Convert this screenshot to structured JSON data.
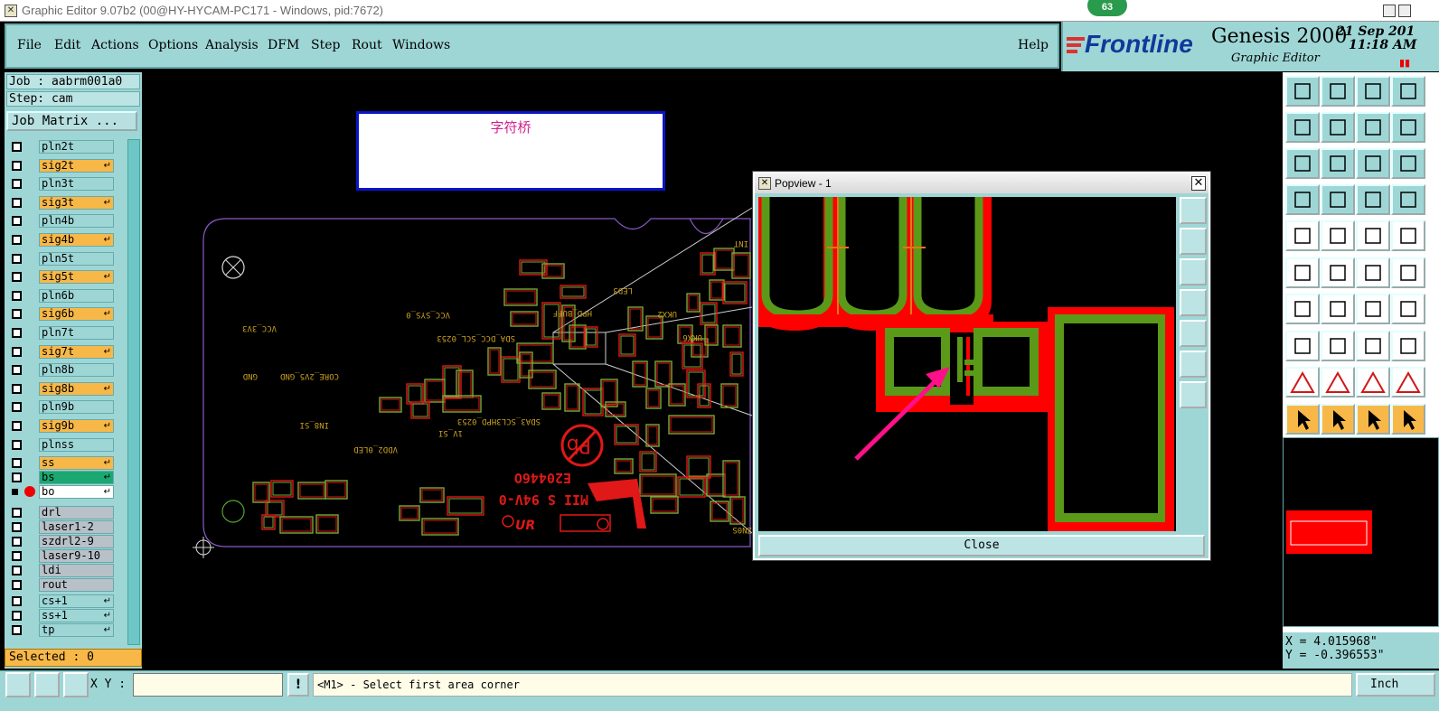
{
  "window": {
    "title": "Graphic Editor 9.07b2 (00@HY-HYCAM-PC171 - Windows, pid:7672)",
    "badge": "63"
  },
  "menu": [
    "File",
    "Edit",
    "Actions",
    "Options",
    "Analysis",
    "DFM",
    "Step",
    "Rout",
    "Windows"
  ],
  "help": "Help",
  "brand": {
    "logo": "Frontline",
    "product": "Genesis 2000",
    "subtitle": "Graphic Editor",
    "date": "21 Sep 201",
    "time": "11:18 AM"
  },
  "left": {
    "job": "Job : aabrm001a0",
    "step": "Step: cam",
    "job_matrix": "Job Matrix ...",
    "selected": "Selected : 0",
    "layers": [
      {
        "name": "pln2t",
        "color": "#9ed6d6"
      },
      {
        "name": "sig2t",
        "color": "#f8b848"
      },
      {
        "name": "pln3t",
        "color": "#9ed6d6"
      },
      {
        "name": "sig3t",
        "color": "#f8b848"
      },
      {
        "name": "pln4b",
        "color": "#9ed6d6"
      },
      {
        "name": "sig4b",
        "color": "#f8b848"
      },
      {
        "name": "pln5t",
        "color": "#9ed6d6"
      },
      {
        "name": "sig5t",
        "color": "#f8b848"
      },
      {
        "name": "pln6b",
        "color": "#9ed6d6"
      },
      {
        "name": "sig6b",
        "color": "#f8b848"
      },
      {
        "name": "pln7t",
        "color": "#9ed6d6"
      },
      {
        "name": "sig7t",
        "color": "#f8b848"
      },
      {
        "name": "pln8b",
        "color": "#9ed6d6"
      },
      {
        "name": "sig8b",
        "color": "#f8b848"
      },
      {
        "name": "pln9b",
        "color": "#9ed6d6"
      },
      {
        "name": "sig9b",
        "color": "#f8b848"
      },
      {
        "name": "plnss",
        "color": "#9ed6d6"
      },
      {
        "name": "ss",
        "color": "#f8b848"
      },
      {
        "name": "bs",
        "color": "#1aa870"
      },
      {
        "name": "bo",
        "color": "#ffffff"
      },
      {
        "name": "drl",
        "color": "#b8c0c8"
      },
      {
        "name": "laser1-2",
        "color": "#b8c0c8"
      },
      {
        "name": "szdrl2-9",
        "color": "#b8c0c8"
      },
      {
        "name": "laser9-10",
        "color": "#b8c0c8"
      },
      {
        "name": "ldi",
        "color": "#b8c0c8"
      },
      {
        "name": "rout",
        "color": "#b8c0c8"
      },
      {
        "name": "cs+1",
        "color": "#9ed6d6"
      },
      {
        "name": "ss+1",
        "color": "#9ed6d6"
      },
      {
        "name": "tp",
        "color": "#9ed6d6"
      }
    ]
  },
  "annotation": "字符桥",
  "board_text": {
    "vcc3v3": "VCC_3V3",
    "vccsys": "VCC_SYS_0",
    "gnd": "GND",
    "core": "CORE_2V5_GND",
    "sda": "SDA_DCC_SCL_0253",
    "sda2": "SDA3_SCL3HPD_0253",
    "hpd": "HPD_BUFF",
    "led": "LED3",
    "vdd": "VDD2_0LED",
    "ix": "1V_SI",
    "ixb": "IN8_SI",
    "ukx": "UKX2",
    "ukx6": "UKX6",
    "pb": "Pb",
    "e20": "E20446O",
    "mii": "MII S 94V-0",
    "zdot": "ZN0S",
    "int": "INT"
  },
  "popview": {
    "title": "Popview - 1",
    "close": "Close"
  },
  "coords": {
    "x": "X = 4.015968\"",
    "y": "Y = -0.396553\""
  },
  "status": {
    "xy_label": "X Y :",
    "excl": "!",
    "prompt": "<M1> - Select first area corner",
    "units": "Inch"
  }
}
